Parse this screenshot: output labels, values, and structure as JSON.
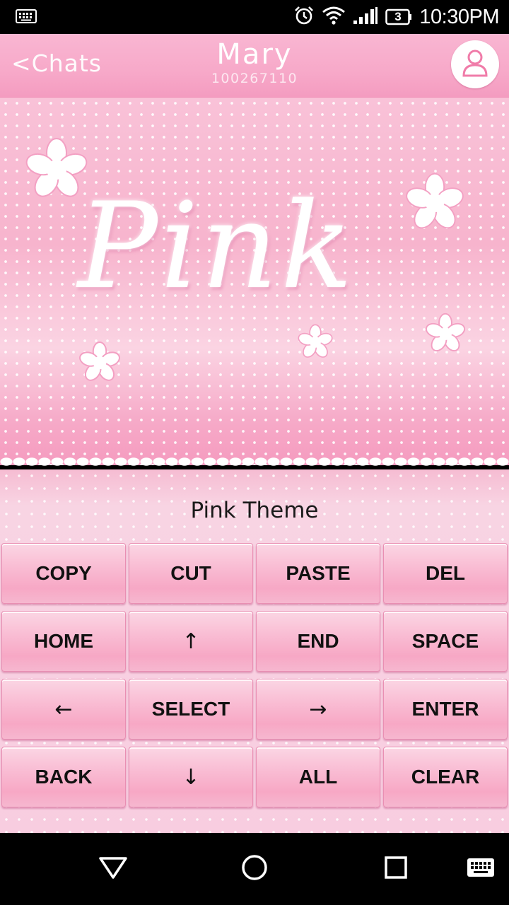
{
  "status_bar": {
    "time": "10:30PM",
    "battery_level": "3",
    "icons": [
      "keyboard-icon",
      "alarm-icon",
      "wifi-icon",
      "signal-icon",
      "battery-icon"
    ]
  },
  "header": {
    "back_label": "<Chats",
    "contact_name": "Mary",
    "contact_id": "100267110",
    "avatar_icon": "person-icon"
  },
  "theme_banner": {
    "word": "Pink",
    "colors": {
      "primary": "#f7a9c9",
      "accent": "#ffffff"
    }
  },
  "keyboard": {
    "title": "Pink Theme",
    "keys": [
      {
        "label": "COPY"
      },
      {
        "label": "CUT"
      },
      {
        "label": "PASTE"
      },
      {
        "label": "DEL"
      },
      {
        "label": "HOME"
      },
      {
        "label": "↑"
      },
      {
        "label": "END"
      },
      {
        "label": "SPACE"
      },
      {
        "label": "←"
      },
      {
        "label": "SELECT"
      },
      {
        "label": "→"
      },
      {
        "label": "ENTER"
      },
      {
        "label": "BACK"
      },
      {
        "label": "↓"
      },
      {
        "label": "ALL"
      },
      {
        "label": "CLEAR"
      }
    ]
  },
  "nav_bar": {
    "buttons": [
      "back-triangle-icon",
      "home-circle-icon",
      "recents-square-icon",
      "keyboard-switch-icon"
    ]
  }
}
